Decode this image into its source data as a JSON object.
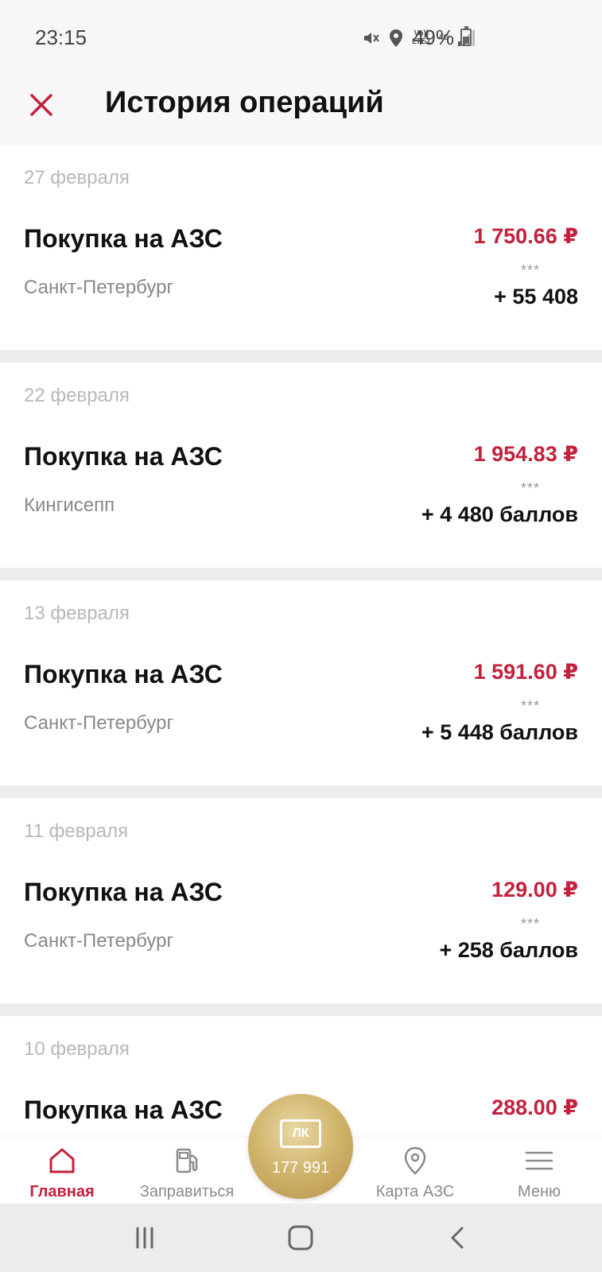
{
  "status_bar": {
    "time": "23:15",
    "battery": "49%",
    "battery_level": 0.49,
    "network_label": "4G",
    "volte_label": "Vo)) LTE1",
    "icons": [
      "mute-icon",
      "location-icon",
      "volte-icon",
      "data-4g-icon",
      "signal-icon",
      "battery-icon"
    ]
  },
  "header": {
    "title": "История операций",
    "close_icon": "close-icon"
  },
  "operations": [
    {
      "date": "27 февраля",
      "title": "Покупка на АЗС",
      "city": "Санкт-Петербург",
      "amount": "1 750.66 ₽",
      "stars": "***",
      "points": "+ 55 408"
    },
    {
      "date": "22 февраля",
      "title": "Покупка на АЗС",
      "city": "Кингисепп",
      "amount": "1 954.83 ₽",
      "stars": "***",
      "points": "+ 4 480 баллов"
    },
    {
      "date": "13 февраля",
      "title": "Покупка на АЗС",
      "city": "Санкт-Петербург",
      "amount": "1 591.60 ₽",
      "stars": "***",
      "points": "+ 5 448 баллов"
    },
    {
      "date": "11 февраля",
      "title": "Покупка на АЗС",
      "city": "Санкт-Петербург",
      "amount": "129.00 ₽",
      "stars": "***",
      "points": "+ 258 баллов"
    },
    {
      "date": "10 февраля",
      "title": "Покупка на АЗС",
      "city": "",
      "amount": "288.00 ₽",
      "stars": "",
      "points": ""
    }
  ],
  "bottom_nav": {
    "items": [
      {
        "label": "Главная",
        "icon": "home-icon",
        "active": true
      },
      {
        "label": "Заправиться",
        "icon": "fuel-pump-icon",
        "active": false
      },
      {
        "label": "Карта АЗС",
        "icon": "map-pin-icon",
        "active": false
      },
      {
        "label": "Меню",
        "icon": "menu-icon",
        "active": false
      }
    ],
    "center": {
      "logo": "ЛК",
      "value": "177 991"
    }
  },
  "colors": {
    "accent": "#c4213c",
    "gold": "#c9a95c",
    "text": "#111111",
    "muted": "#888888"
  }
}
